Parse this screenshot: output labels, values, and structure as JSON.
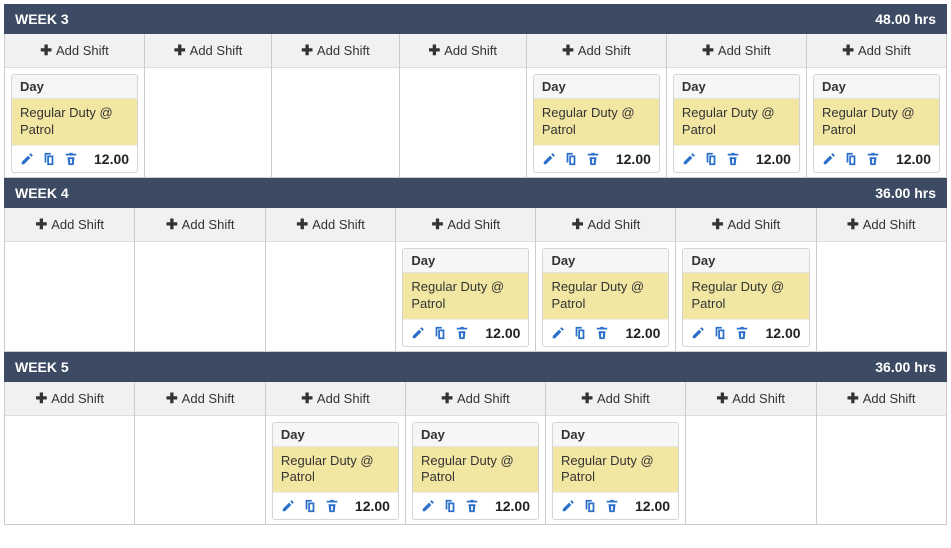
{
  "labels": {
    "addShift": "Add Shift",
    "hoursSuffix": "hrs"
  },
  "weeks": [
    {
      "title": "WEEK 3",
      "hours": "48.00",
      "days": [
        {
          "shift": {
            "label": "Day",
            "desc": "Regular Duty @ Patrol",
            "hours": "12.00"
          }
        },
        {
          "shift": null
        },
        {
          "shift": null
        },
        {
          "shift": null
        },
        {
          "shift": {
            "label": "Day",
            "desc": "Regular Duty @ Patrol",
            "hours": "12.00"
          }
        },
        {
          "shift": {
            "label": "Day",
            "desc": "Regular Duty @ Patrol",
            "hours": "12.00"
          }
        },
        {
          "shift": {
            "label": "Day",
            "desc": "Regular Duty @ Patrol",
            "hours": "12.00"
          }
        }
      ]
    },
    {
      "title": "WEEK 4",
      "hours": "36.00",
      "days": [
        {
          "shift": null
        },
        {
          "shift": null
        },
        {
          "shift": null
        },
        {
          "shift": {
            "label": "Day",
            "desc": "Regular Duty @ Patrol",
            "hours": "12.00"
          }
        },
        {
          "shift": {
            "label": "Day",
            "desc": "Regular Duty @ Patrol",
            "hours": "12.00"
          }
        },
        {
          "shift": {
            "label": "Day",
            "desc": "Regular Duty @ Patrol",
            "hours": "12.00"
          }
        },
        {
          "shift": null
        }
      ]
    },
    {
      "title": "WEEK 5",
      "hours": "36.00",
      "days": [
        {
          "shift": null
        },
        {
          "shift": null
        },
        {
          "shift": {
            "label": "Day",
            "desc": "Regular Duty @ Patrol",
            "hours": "12.00"
          }
        },
        {
          "shift": {
            "label": "Day",
            "desc": "Regular Duty @ Patrol",
            "hours": "12.00"
          }
        },
        {
          "shift": {
            "label": "Day",
            "desc": "Regular Duty @ Patrol",
            "hours": "12.00"
          }
        },
        {
          "shift": null
        },
        {
          "shift": null
        }
      ]
    }
  ]
}
